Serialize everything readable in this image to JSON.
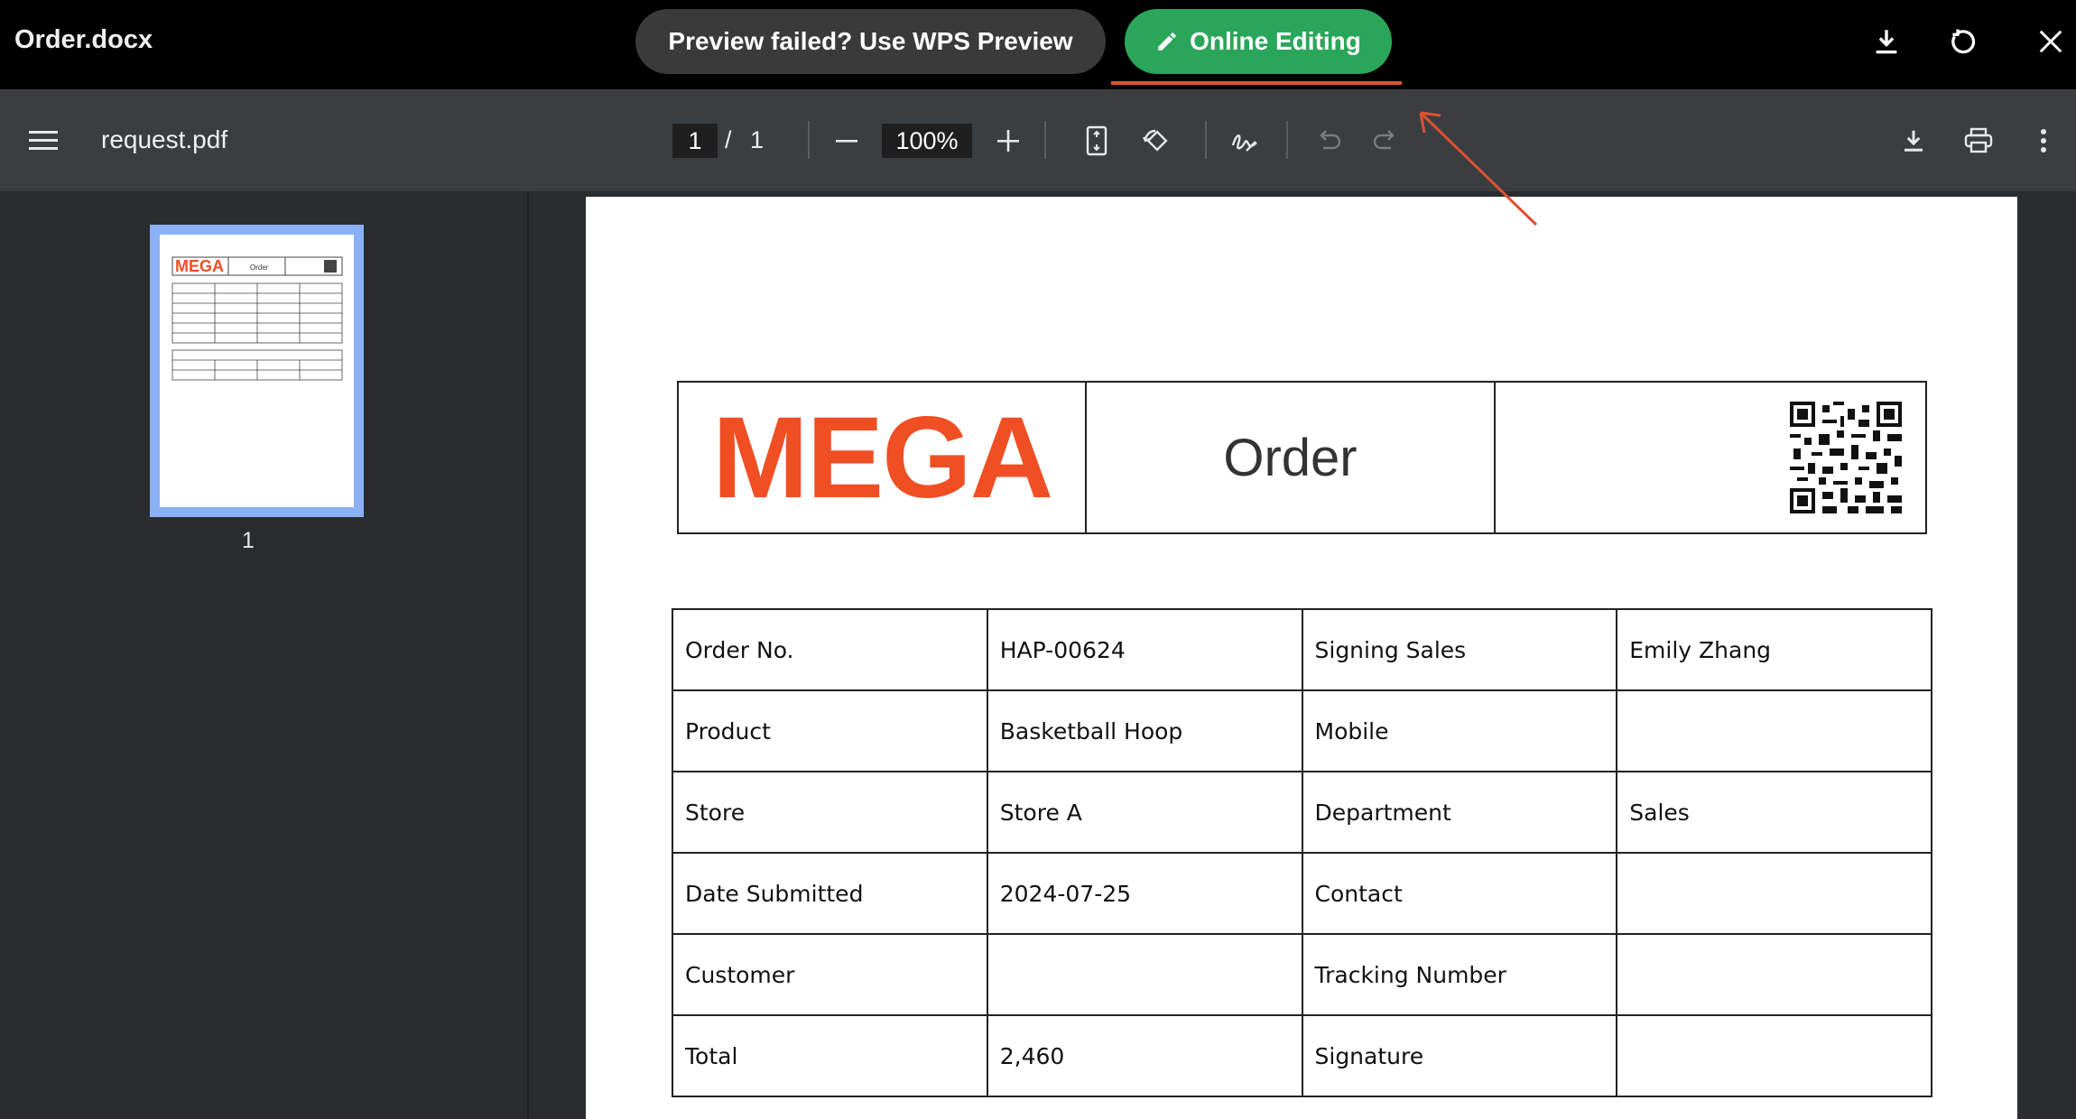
{
  "window": {
    "title": "Order.docx",
    "wps_preview_label": "Preview failed? Use WPS Preview",
    "online_editing_label": "Online Editing",
    "accent_green": "#2aa65a",
    "annotation_color": "#e05234"
  },
  "pdf_toolbar": {
    "file_name": "request.pdf",
    "current_page": "1",
    "page_separator": "/",
    "total_pages": "1",
    "zoom": "100%"
  },
  "sidebar": {
    "thumbnails": [
      {
        "page_number": "1"
      }
    ]
  },
  "document": {
    "logo": "MEGA",
    "logo_color": "#f04e23",
    "title": "Order",
    "rows": [
      [
        "Order No.",
        "HAP-00624",
        "Signing Sales",
        "Emily Zhang"
      ],
      [
        "Product",
        "Basketball Hoop",
        "Mobile",
        ""
      ],
      [
        "Store",
        "Store A",
        "Department",
        "Sales"
      ],
      [
        "Date Submitted",
        "2024-07-25",
        "Contact",
        ""
      ],
      [
        "Customer",
        "",
        "Tracking Number",
        ""
      ],
      [
        "Total",
        "2,460",
        "Signature",
        ""
      ]
    ]
  }
}
